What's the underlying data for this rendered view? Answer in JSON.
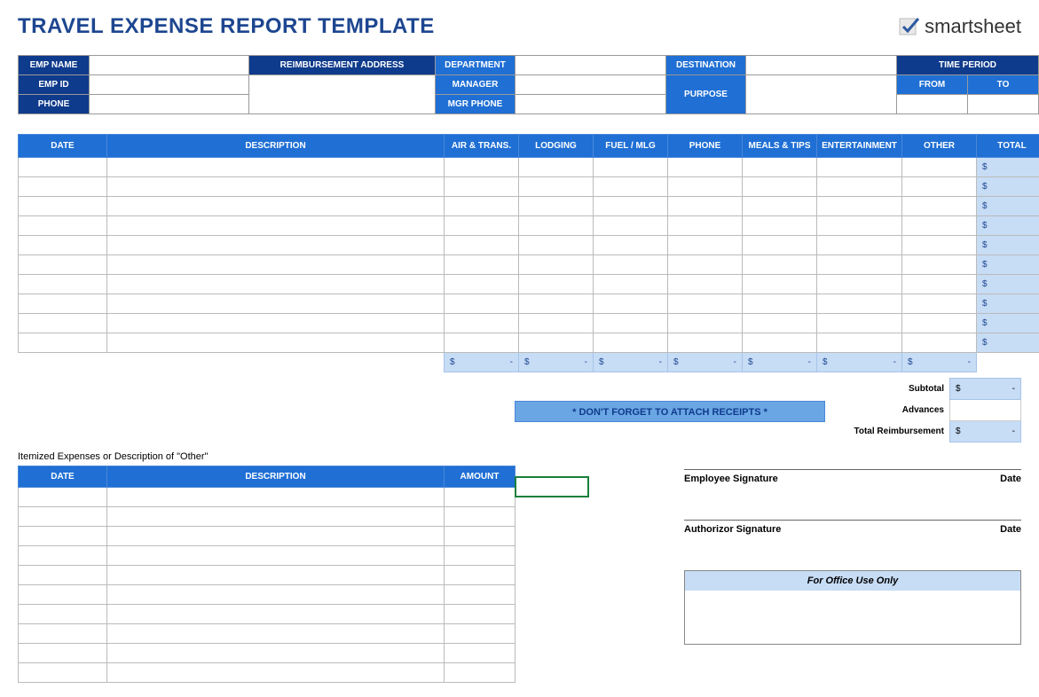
{
  "title": "TRAVEL EXPENSE REPORT TEMPLATE",
  "brand": "smartsheet",
  "info": {
    "emp_name": "EMP NAME",
    "reimb_addr": "REIMBURSEMENT ADDRESS",
    "department": "DEPARTMENT",
    "destination": "DESTINATION",
    "time_period": "TIME PERIOD",
    "emp_id": "EMP ID",
    "manager": "MANAGER",
    "purpose": "PURPOSE",
    "from": "FROM",
    "to": "TO",
    "phone": "PHONE",
    "mgr_phone": "MGR PHONE"
  },
  "cols": {
    "date": "DATE",
    "description": "DESCRIPTION",
    "air_trans": "AIR & TRANS.",
    "lodging": "LODGING",
    "fuel_mlg": "FUEL / MLG",
    "phone": "PHONE",
    "meals_tips": "MEALS & TIPS",
    "entertainment": "ENTERTAINMENT",
    "other": "OTHER",
    "total": "TOTAL"
  },
  "row_total": {
    "dollar": "$",
    "dash": "-"
  },
  "receipts_note": "* DON'T FORGET TO ATTACH RECEIPTS *",
  "summary": {
    "subtotal": "Subtotal",
    "advances": "Advances",
    "total_reimb": "Total Reimbursement"
  },
  "itemized": {
    "title": "Itemized Expenses or Description of \"Other\"",
    "date": "DATE",
    "description": "DESCRIPTION",
    "amount": "AMOUNT"
  },
  "sig": {
    "emp": "Employee Signature",
    "auth": "Authorizor Signature",
    "date": "Date"
  },
  "office": "For Office Use Only"
}
